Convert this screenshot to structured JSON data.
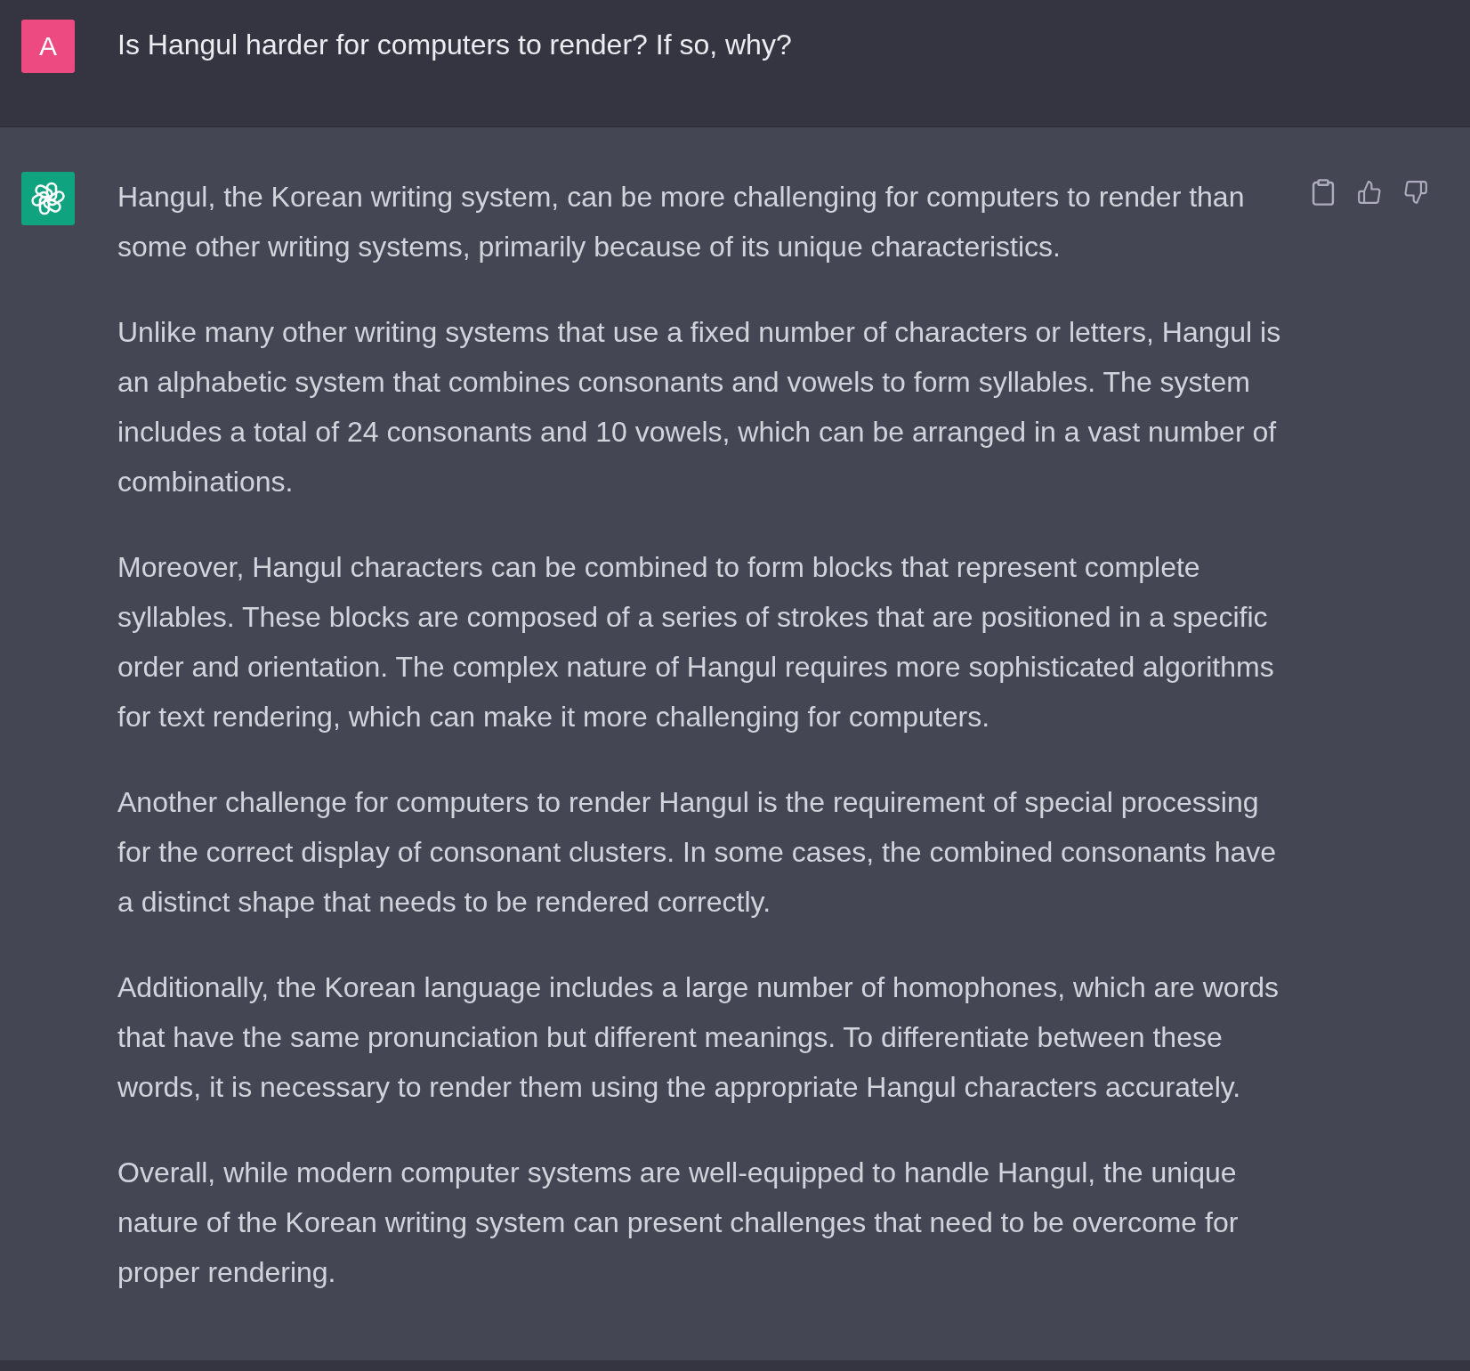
{
  "user_message": {
    "avatar_letter": "A",
    "text": "Is Hangul harder for computers to render? If so, why?"
  },
  "assistant_message": {
    "paragraphs": [
      "Hangul, the Korean writing system, can be more challenging for computers to render than some other writing systems, primarily because of its unique characteristics.",
      "Unlike many other writing systems that use a fixed number of characters or letters, Hangul is an alphabetic system that combines consonants and vowels to form syllables. The system includes a total of 24 consonants and 10 vowels, which can be arranged in a vast number of combinations.",
      "Moreover, Hangul characters can be combined to form blocks that represent complete syllables. These blocks are composed of a series of strokes that are positioned in a specific order and orientation. The complex nature of Hangul requires more sophisticated algorithms for text rendering, which can make it more challenging for computers.",
      "Another challenge for computers to render Hangul is the requirement of special processing for the correct display of consonant clusters. In some cases, the combined consonants have a distinct shape that needs to be rendered correctly.",
      "Additionally, the Korean language includes a large number of homophones, which are words that have the same pronunciation but different meanings. To differentiate between these words, it is necessary to render them using the appropriate Hangul characters accurately.",
      "Overall, while modern computer systems are well-equipped to handle Hangul, the unique nature of the Korean writing system can present challenges that need to be overcome for proper rendering."
    ]
  }
}
